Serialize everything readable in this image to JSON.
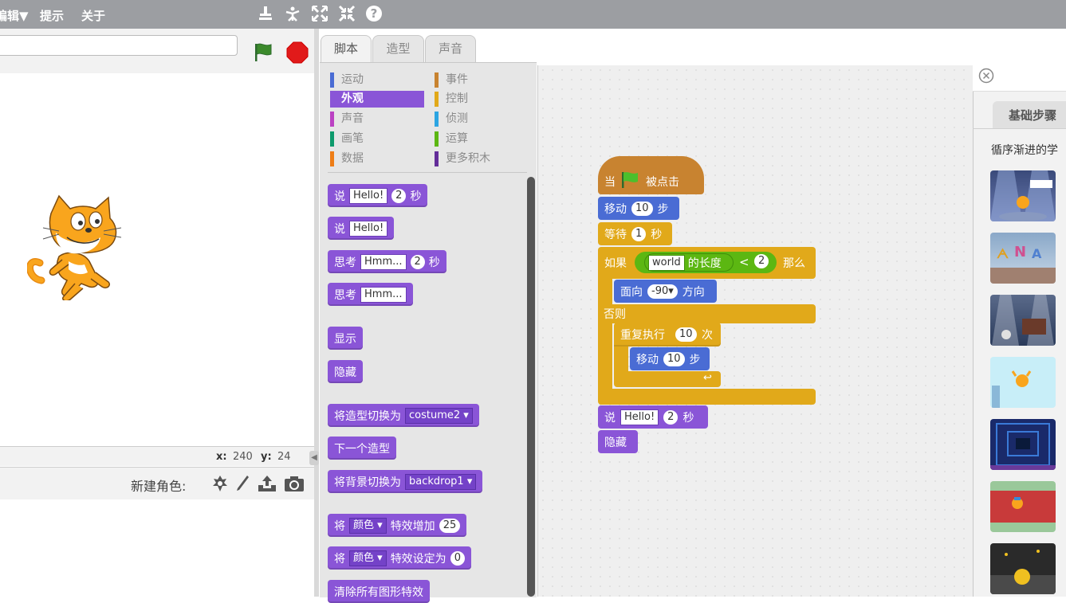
{
  "menu": {
    "edit": "编辑▼",
    "tips": "提示",
    "about": "关于"
  },
  "toolbar_icons": [
    "duplicate-icon",
    "delete-icon",
    "grow-icon",
    "shrink-icon",
    "help-icon"
  ],
  "stage": {
    "coords_x_label": "x:",
    "coords_x": "240",
    "coords_y_label": "y:",
    "coords_y": "24",
    "new_sprite_label": "新建角色:"
  },
  "tabs": [
    "脚本",
    "造型",
    "声音"
  ],
  "categories": [
    {
      "label": "运动",
      "color": "#4a6cd4"
    },
    {
      "label": "外观",
      "color": "#8a55d7",
      "selected": true
    },
    {
      "label": "声音",
      "color": "#bb42c3"
    },
    {
      "label": "画笔",
      "color": "#0e9a6c"
    },
    {
      "label": "数据",
      "color": "#ee7d16"
    },
    {
      "label": "事件",
      "color": "#c88330"
    },
    {
      "label": "控制",
      "color": "#e1a91a"
    },
    {
      "label": "侦测",
      "color": "#2ca5e2"
    },
    {
      "label": "运算",
      "color": "#5cb712"
    },
    {
      "label": "更多积木",
      "color": "#632d99"
    }
  ],
  "palette_blocks": {
    "say_secs": {
      "label": "说",
      "text": "Hello!",
      "num": "2",
      "unit": "秒"
    },
    "say": {
      "label": "说",
      "text": "Hello!"
    },
    "think_secs": {
      "label": "思考",
      "text": "Hmm...",
      "num": "2",
      "unit": "秒"
    },
    "think": {
      "label": "思考",
      "text": "Hmm..."
    },
    "show": "显示",
    "hide": "隐藏",
    "switch_costume": {
      "label": "将造型切换为",
      "value": "costume2"
    },
    "next_costume": "下一个造型",
    "switch_backdrop": {
      "label": "将背景切换为",
      "value": "backdrop1"
    },
    "change_effect": {
      "label": "将",
      "effect": "颜色",
      "action": "特效增加",
      "num": "25"
    },
    "set_effect": {
      "label": "将",
      "effect": "颜色",
      "action": "特效设定为",
      "num": "0"
    },
    "clear_effects": "清除所有图形特效"
  },
  "script": {
    "hat_when": "当",
    "hat_clicked": "被点击",
    "move1": {
      "label": "移动",
      "num": "10",
      "unit": "步"
    },
    "wait": {
      "label": "等待",
      "num": "1",
      "unit": "秒"
    },
    "if_label": "如果",
    "then_label": "那么",
    "length": {
      "text": "world",
      "label": "的长度"
    },
    "lt": "<",
    "lt_num": "2",
    "point": {
      "label": "面向",
      "value": "-90▾",
      "unit": "方向"
    },
    "else_label": "否则",
    "repeat": {
      "label": "重复执行",
      "num": "10",
      "unit": "次"
    },
    "move2": {
      "label": "移动",
      "num": "10",
      "unit": "步"
    },
    "say": {
      "label": "说",
      "text": "Hello!",
      "num": "2",
      "unit": "秒"
    },
    "hide": "隐藏"
  },
  "tips": {
    "tab": "基础步骤",
    "text": "循序渐进的学"
  }
}
